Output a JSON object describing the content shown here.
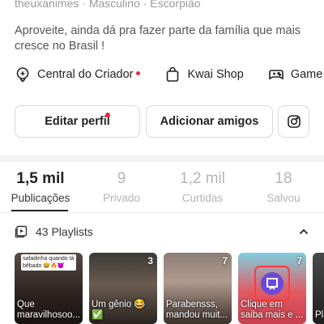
{
  "profile": {
    "meta_line": "theuxanimes · Masculino · Escorpião",
    "bio": "Aproveite, ainda dá pra fazer parte da família que mais cresce no Brasil !"
  },
  "shortcuts": [
    {
      "label": "Central do Criador",
      "icon": "creator-pin-icon",
      "has_badge": true
    },
    {
      "label": "Kwai Shop",
      "icon": "shopping-bag-icon",
      "has_badge": false
    },
    {
      "label": "Game",
      "icon": "gamepad-icon",
      "has_badge": false
    }
  ],
  "actions": {
    "edit_label": "Editar perfil",
    "add_label": "Adicionar amigos",
    "instagram_icon": "instagram-icon"
  },
  "stats": [
    {
      "value": "1,5 mil",
      "label": "Publicações",
      "active": true
    },
    {
      "value": "9",
      "label": "Privado",
      "active": false
    },
    {
      "value": "1,2 mil",
      "label": "Curtidas",
      "active": false
    },
    {
      "value": "18",
      "label": "Salvou",
      "active": false
    }
  ],
  "playlists": {
    "label": "43 Playlists",
    "items": [
      {
        "top_text": "safadinha quando tá bêbado 😂🔥😈",
        "count": "",
        "caption": "Que maravilhosoo..."
      },
      {
        "top_text": "",
        "count": "3",
        "caption": "Um gênio 😂✅"
      },
      {
        "top_text": "",
        "count": "7",
        "caption": "Parabensss, mandou muit..."
      },
      {
        "top_text": "",
        "count": "7",
        "caption": "Clique em saiba mais e ..."
      },
      {
        "top_text": "",
        "count": "",
        "caption": "Pla"
      }
    ]
  },
  "colors": {
    "accent_red": "#e8293b",
    "text_primary": "#222222",
    "text_muted": "#b5b5b5"
  }
}
